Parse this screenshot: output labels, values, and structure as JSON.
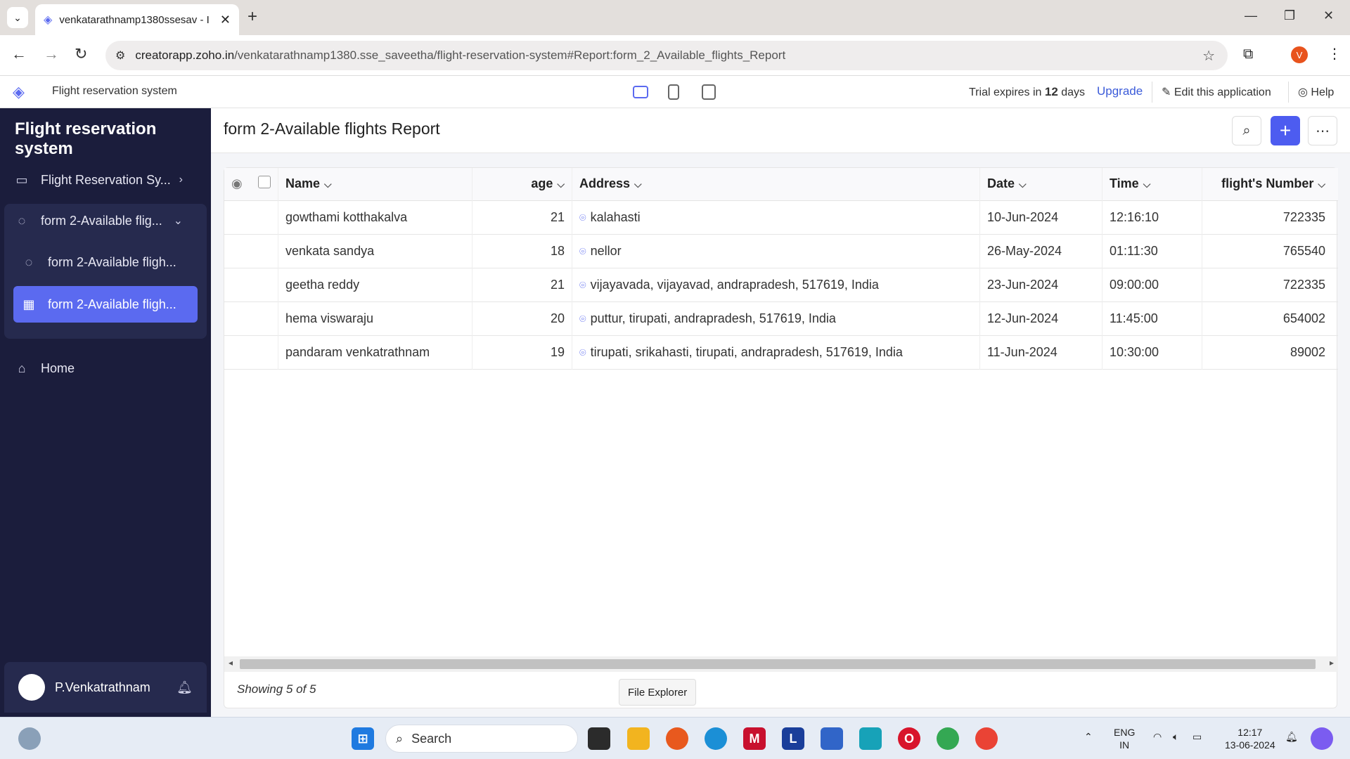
{
  "browser": {
    "tab_title": "venkatarathnamp1380ssesav - I",
    "url_host": "creatorapp.zoho.in",
    "url_path": "/venkatarathnamp1380.sse_saveetha/flight-reservation-system#Report:form_2_Available_flights_Report"
  },
  "topbar": {
    "app_name": "Flight reservation system",
    "trial_prefix": "Trial expires in ",
    "trial_days": "12",
    "trial_suffix": " days",
    "upgrade": "Upgrade",
    "edit_app": "Edit this application",
    "help": "Help"
  },
  "sidebar": {
    "title": "Flight reservation system",
    "items": [
      {
        "label": "Flight Reservation Sy..."
      },
      {
        "label": "form 2-Available flig..."
      },
      {
        "label": "form 2-Available fligh..."
      },
      {
        "label": "form 2-Available fligh..."
      },
      {
        "label": "Home"
      }
    ],
    "user": "P.Venkatrathnam"
  },
  "report": {
    "title": "form 2-Available flights Report",
    "columns": [
      "Name",
      "age",
      "Address",
      "Date",
      "Time",
      "flight's Number"
    ],
    "rows": [
      {
        "name": "gowthami kotthakalva",
        "age": "21",
        "address": "kalahasti",
        "date": "10-Jun-2024",
        "time": "12:16:10",
        "flight": "722335"
      },
      {
        "name": "venkata sandya",
        "age": "18",
        "address": "nellor",
        "date": "26-May-2024",
        "time": "01:11:30",
        "flight": "765540"
      },
      {
        "name": "geetha reddy",
        "age": "21",
        "address": "vijayavada, vijayavad, andrapradesh, 517619, India",
        "date": "23-Jun-2024",
        "time": "09:00:00",
        "flight": "722335"
      },
      {
        "name": "hema viswaraju",
        "age": "20",
        "address": "puttur, tirupati, andrapradesh, 517619, India",
        "date": "12-Jun-2024",
        "time": "11:45:00",
        "flight": "654002"
      },
      {
        "name": "pandaram venkatrathnam",
        "age": "19",
        "address": "tirupati, srikahasti, tirupati, andrapradesh, 517619, India",
        "date": "11-Jun-2024",
        "time": "10:30:00",
        "flight": "89002"
      }
    ],
    "showing": "Showing 5 of 5"
  },
  "tooltip": "File Explorer",
  "taskbar": {
    "search_placeholder": "Search",
    "lang_top": "ENG",
    "lang_bottom": "IN",
    "time": "12:17",
    "date": "13-06-2024"
  }
}
